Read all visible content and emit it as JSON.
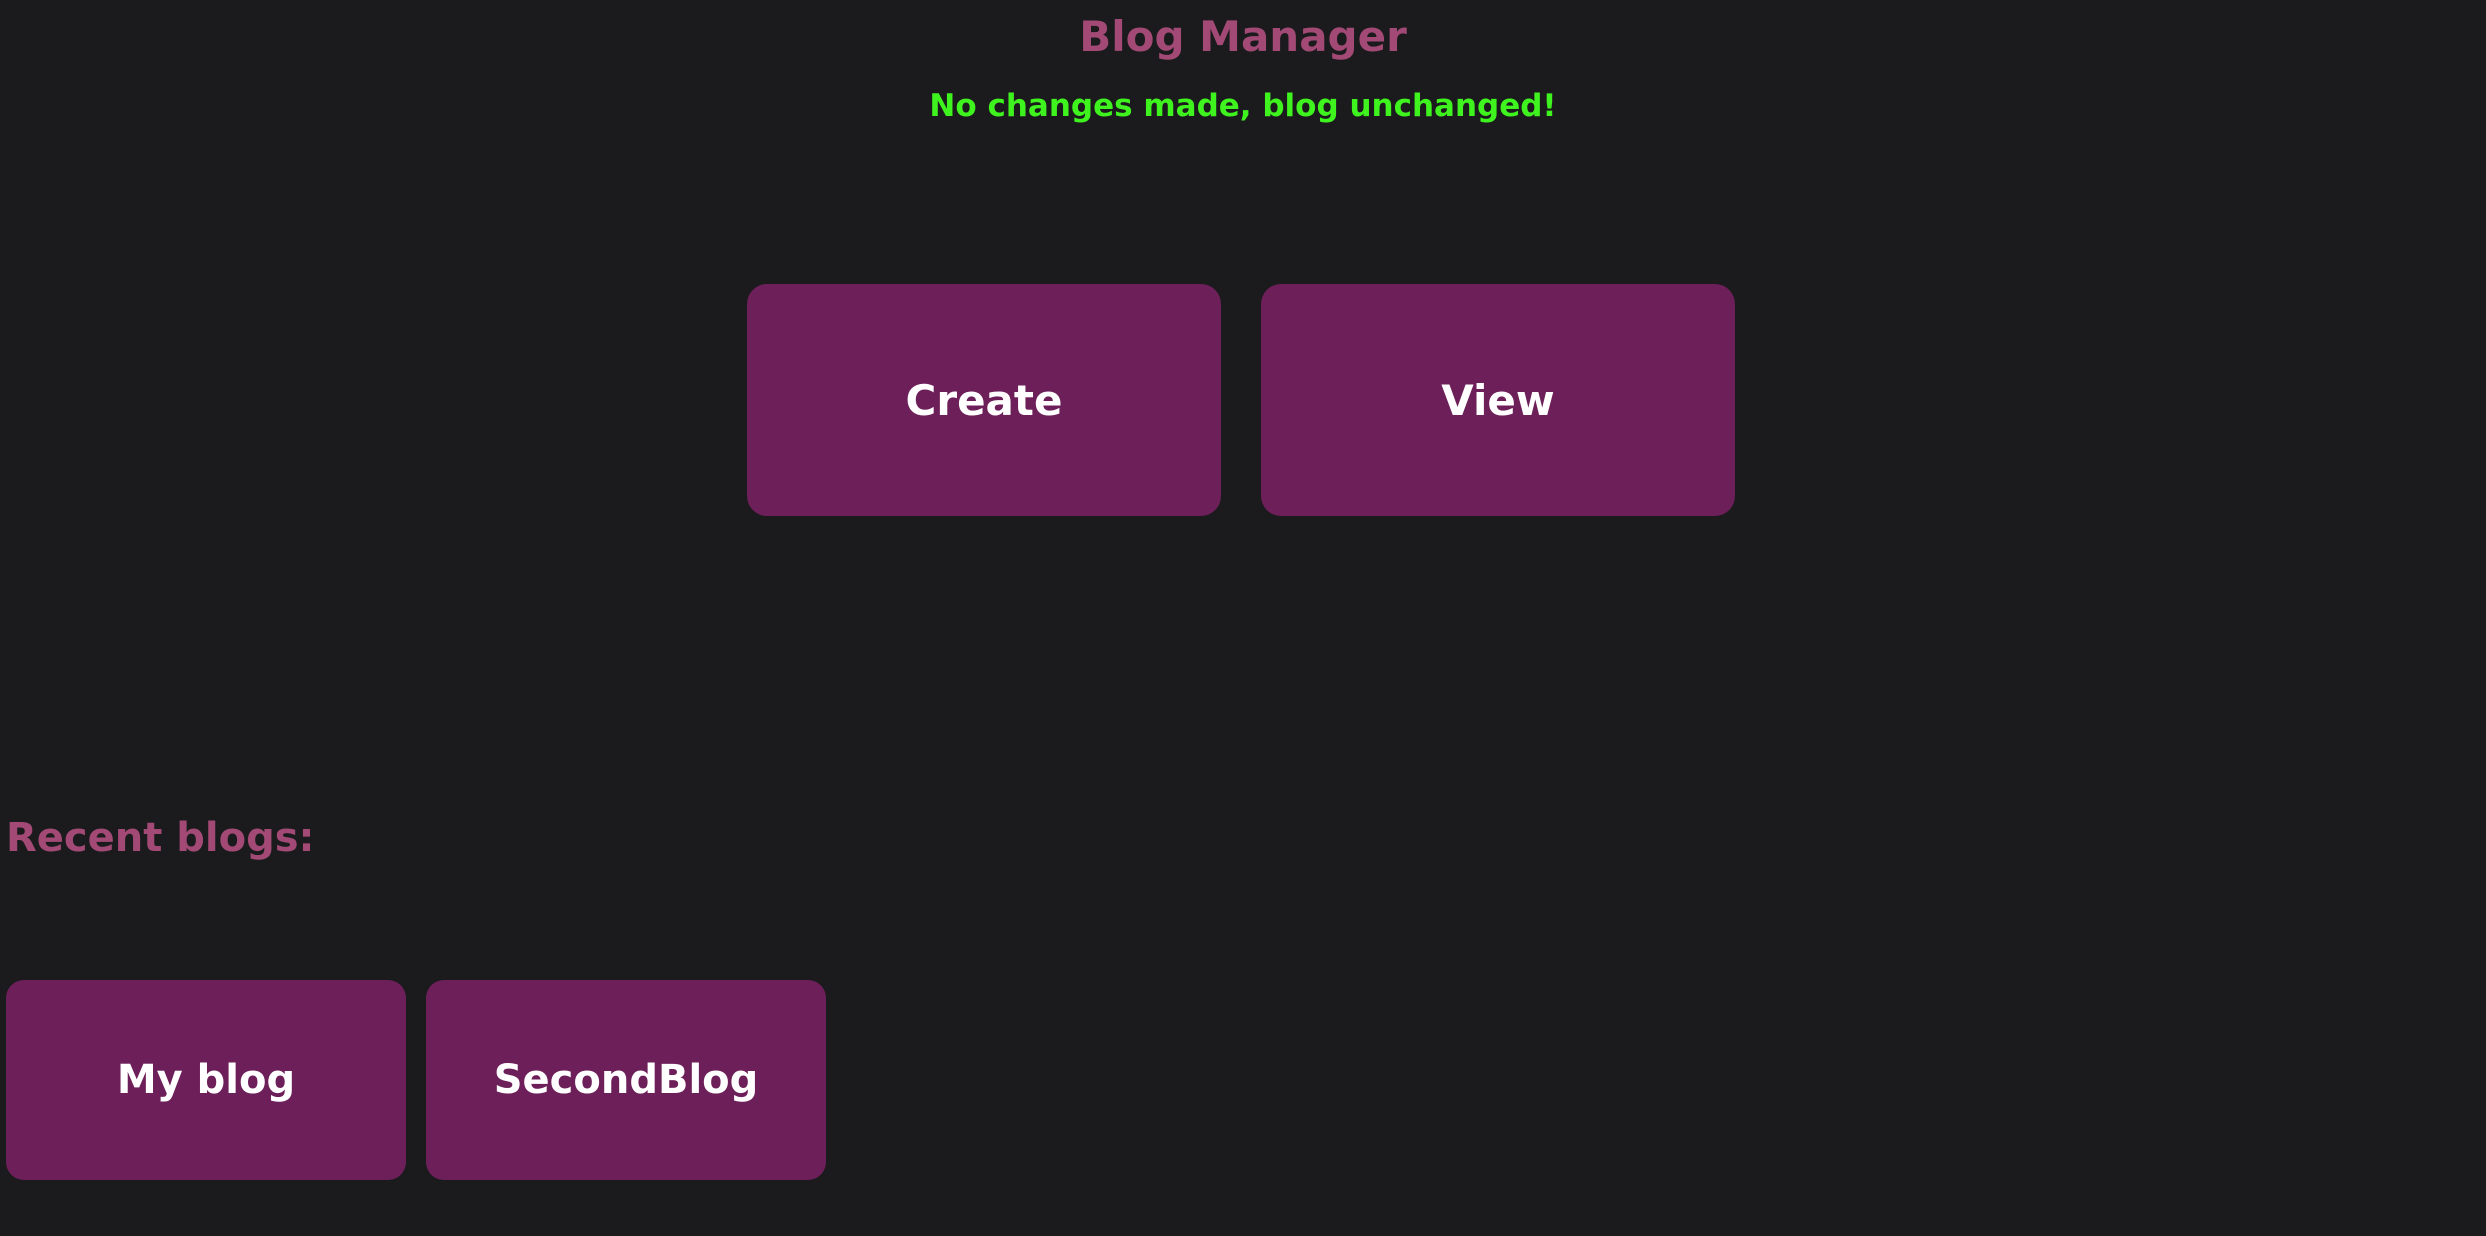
{
  "header": {
    "title": "Blog Manager",
    "status_message": "No changes made, blog unchanged!"
  },
  "actions": {
    "create_label": "Create",
    "view_label": "View"
  },
  "recent": {
    "heading": "Recent blogs:",
    "blogs": [
      {
        "title": "My blog"
      },
      {
        "title": "SecondBlog"
      }
    ]
  },
  "colors": {
    "background": "#1b1b1d",
    "accent": "#a24a75",
    "button": "#6d1f59",
    "success": "#3ff31f",
    "button_text": "#ffffff"
  }
}
